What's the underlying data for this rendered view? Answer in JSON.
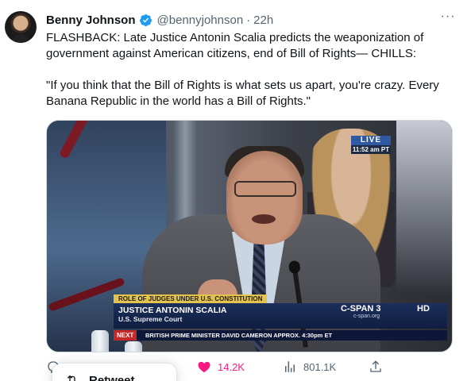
{
  "tweet": {
    "author_name": "Benny Johnson",
    "handle": "@bennyjohnson",
    "separator": "·",
    "time": "22h",
    "text": "FLASHBACK: Late Justice Antonin Scalia predicts the weaponization of government against American citizens, end of Bill of Rights— CHILLS:\n\n\"If you think that the Bill of Rights is what sets us apart, you're crazy. Every Banana Republic in the world has a Bill of Rights.\"",
    "more_icon": "more-dots-icon",
    "verified_icon": "verified-badge-icon",
    "accent_color": "#1d9bf0"
  },
  "video": {
    "live_label": "LIVE",
    "live_time": "11:52 am PT",
    "topic_tag": "ROLE OF JUDGES UNDER U.S. CONSTITUTION",
    "speaker_name": "JUSTICE ANTONIN SCALIA",
    "speaker_title": "U.S. Supreme Court",
    "network": "C-SPAN 3",
    "network_url": "c-span.org",
    "hd_label": "HD",
    "next_label": "NEXT",
    "next_text": "BRITISH PRIME MINISTER DAVID CAMERON  APPROX. 4:30pm ET"
  },
  "actions": {
    "likes": "14.2K",
    "views": "801.1K",
    "like_color": "#f91880"
  },
  "menu": {
    "retweet_label": "Retweet"
  }
}
